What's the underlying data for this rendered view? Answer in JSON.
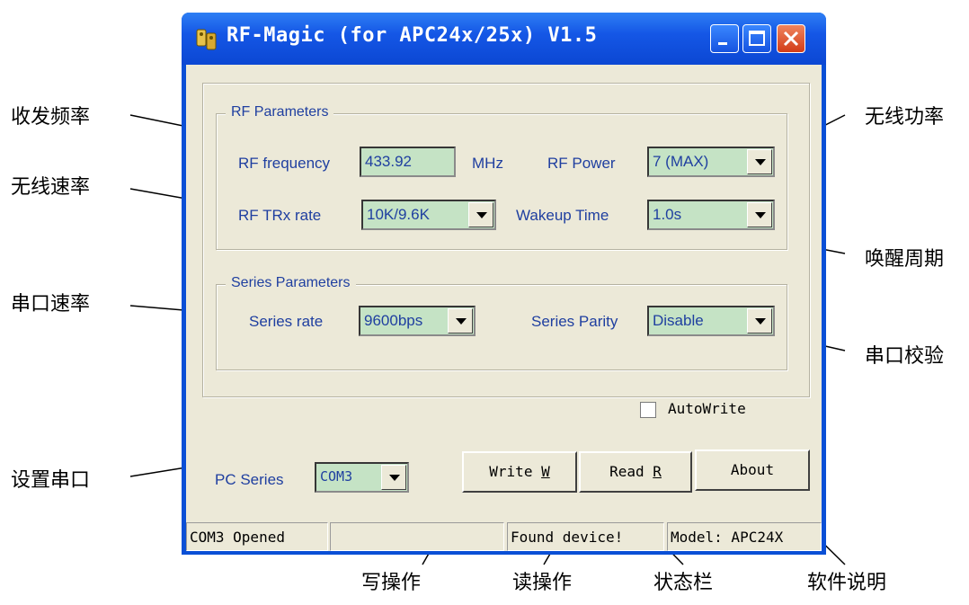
{
  "window": {
    "title": "RF-Magic (for APC24x/25x) V1.5"
  },
  "rf_group": {
    "title": "RF Parameters",
    "frequency_label": "RF frequency",
    "frequency_value": "433.92",
    "frequency_unit": "MHz",
    "power_label": "RF Power",
    "power_value": "7 (MAX)",
    "rate_label": "RF TRx rate",
    "rate_value": "10K/9.6K",
    "wakeup_label": "Wakeup Time",
    "wakeup_value": "1.0s"
  },
  "series_group": {
    "title": "Series  Parameters",
    "rate_label": "Series rate",
    "rate_value": "9600bps",
    "parity_label": "Series Parity",
    "parity_value": "Disable"
  },
  "autowrite": {
    "label": "AutoWrite",
    "checked": false
  },
  "pc_series": {
    "label": "PC  Series",
    "value": "COM3"
  },
  "buttons": {
    "write_text": "Write ",
    "write_key": "W",
    "read_text": "Read ",
    "read_key": "R",
    "about": "About"
  },
  "status_bar": {
    "pane1": "COM3 Opened",
    "pane2": "",
    "pane3": "Found device!",
    "pane4": "Model: APC24X"
  },
  "annotations": {
    "freq": "收发频率",
    "rate": "无线速率",
    "serial_rate": "串口速率",
    "set_port": "设置串口",
    "power": "无线功率",
    "wakeup": "唤醒周期",
    "parity": "串口校验",
    "write": "写操作",
    "read": "读操作",
    "status": "状态栏",
    "about": "软件说明"
  },
  "colors": {
    "titlebar": "#0b47d3",
    "window_face": "#ece9d8",
    "field_bg": "#c5e3c5",
    "label_text": "#1f3fa0",
    "close_button": "#d23c17"
  }
}
